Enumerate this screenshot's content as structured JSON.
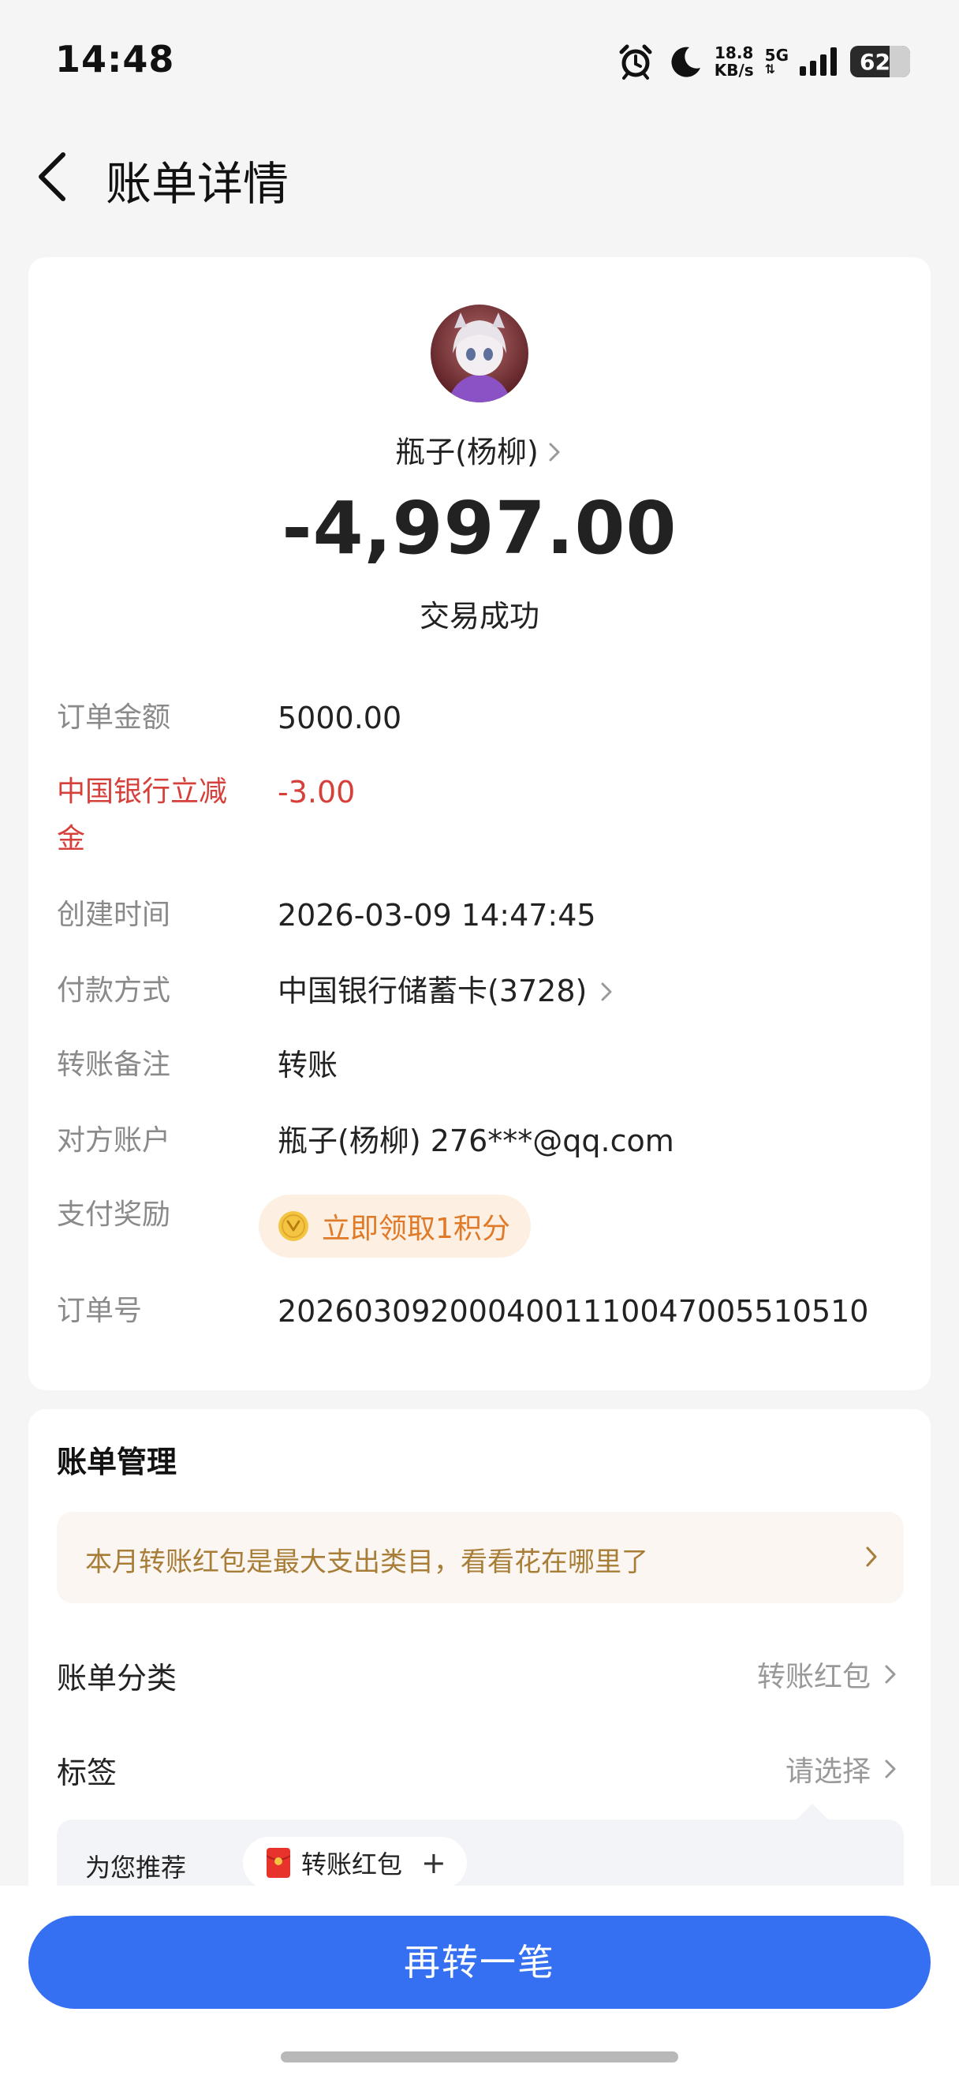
{
  "status_bar": {
    "time": "14:48",
    "net_speed_value": "18.8",
    "net_speed_unit": "KB/s",
    "network": "5G",
    "battery": "62"
  },
  "header": {
    "title": "账单详情"
  },
  "summary": {
    "payee": "瓶子(杨柳)",
    "amount": "-4,997.00",
    "status": "交易成功"
  },
  "details": {
    "order_amount_label": "订单金额",
    "order_amount_value": "5000.00",
    "discount_label_line1": "中国银行立减",
    "discount_label_line2": "金",
    "discount_value": "-3.00",
    "created_label": "创建时间",
    "created_value": "2026-03-09 14:47:45",
    "payment_label": "付款方式",
    "payment_value": "中国银行储蓄卡(3728)",
    "memo_label": "转账备注",
    "memo_value": "转账",
    "account_label": "对方账户",
    "account_value": "瓶子(杨柳) 276***@qq.com",
    "reward_label": "支付奖励",
    "reward_button": "立即领取1积分",
    "order_no_label": "订单号",
    "order_no_value": "2026030920004001110047005510510"
  },
  "manage": {
    "title": "账单管理",
    "insight": "本月转账红包是最大支出类目，看看花在哪里了",
    "category_label": "账单分类",
    "category_value": "转账红包",
    "tag_label": "标签",
    "tag_value": "请选择",
    "recommend_label": "为您推荐",
    "recommend_tag": "转账红包",
    "recommend_add": "+"
  },
  "footer": {
    "primary_button": "再转一笔"
  },
  "colors": {
    "accent_blue": "#3670f2",
    "discount_red": "#d6403b",
    "reward_orange": "#e07a28",
    "insight_gold": "#a77d37"
  },
  "icons": {
    "status": [
      "alarm-icon",
      "moon-icon",
      "signal-icon",
      "battery-icon"
    ],
    "nav": "back-arrow-icon",
    "reward": "coin-icon",
    "tag": "red-envelope-icon"
  }
}
